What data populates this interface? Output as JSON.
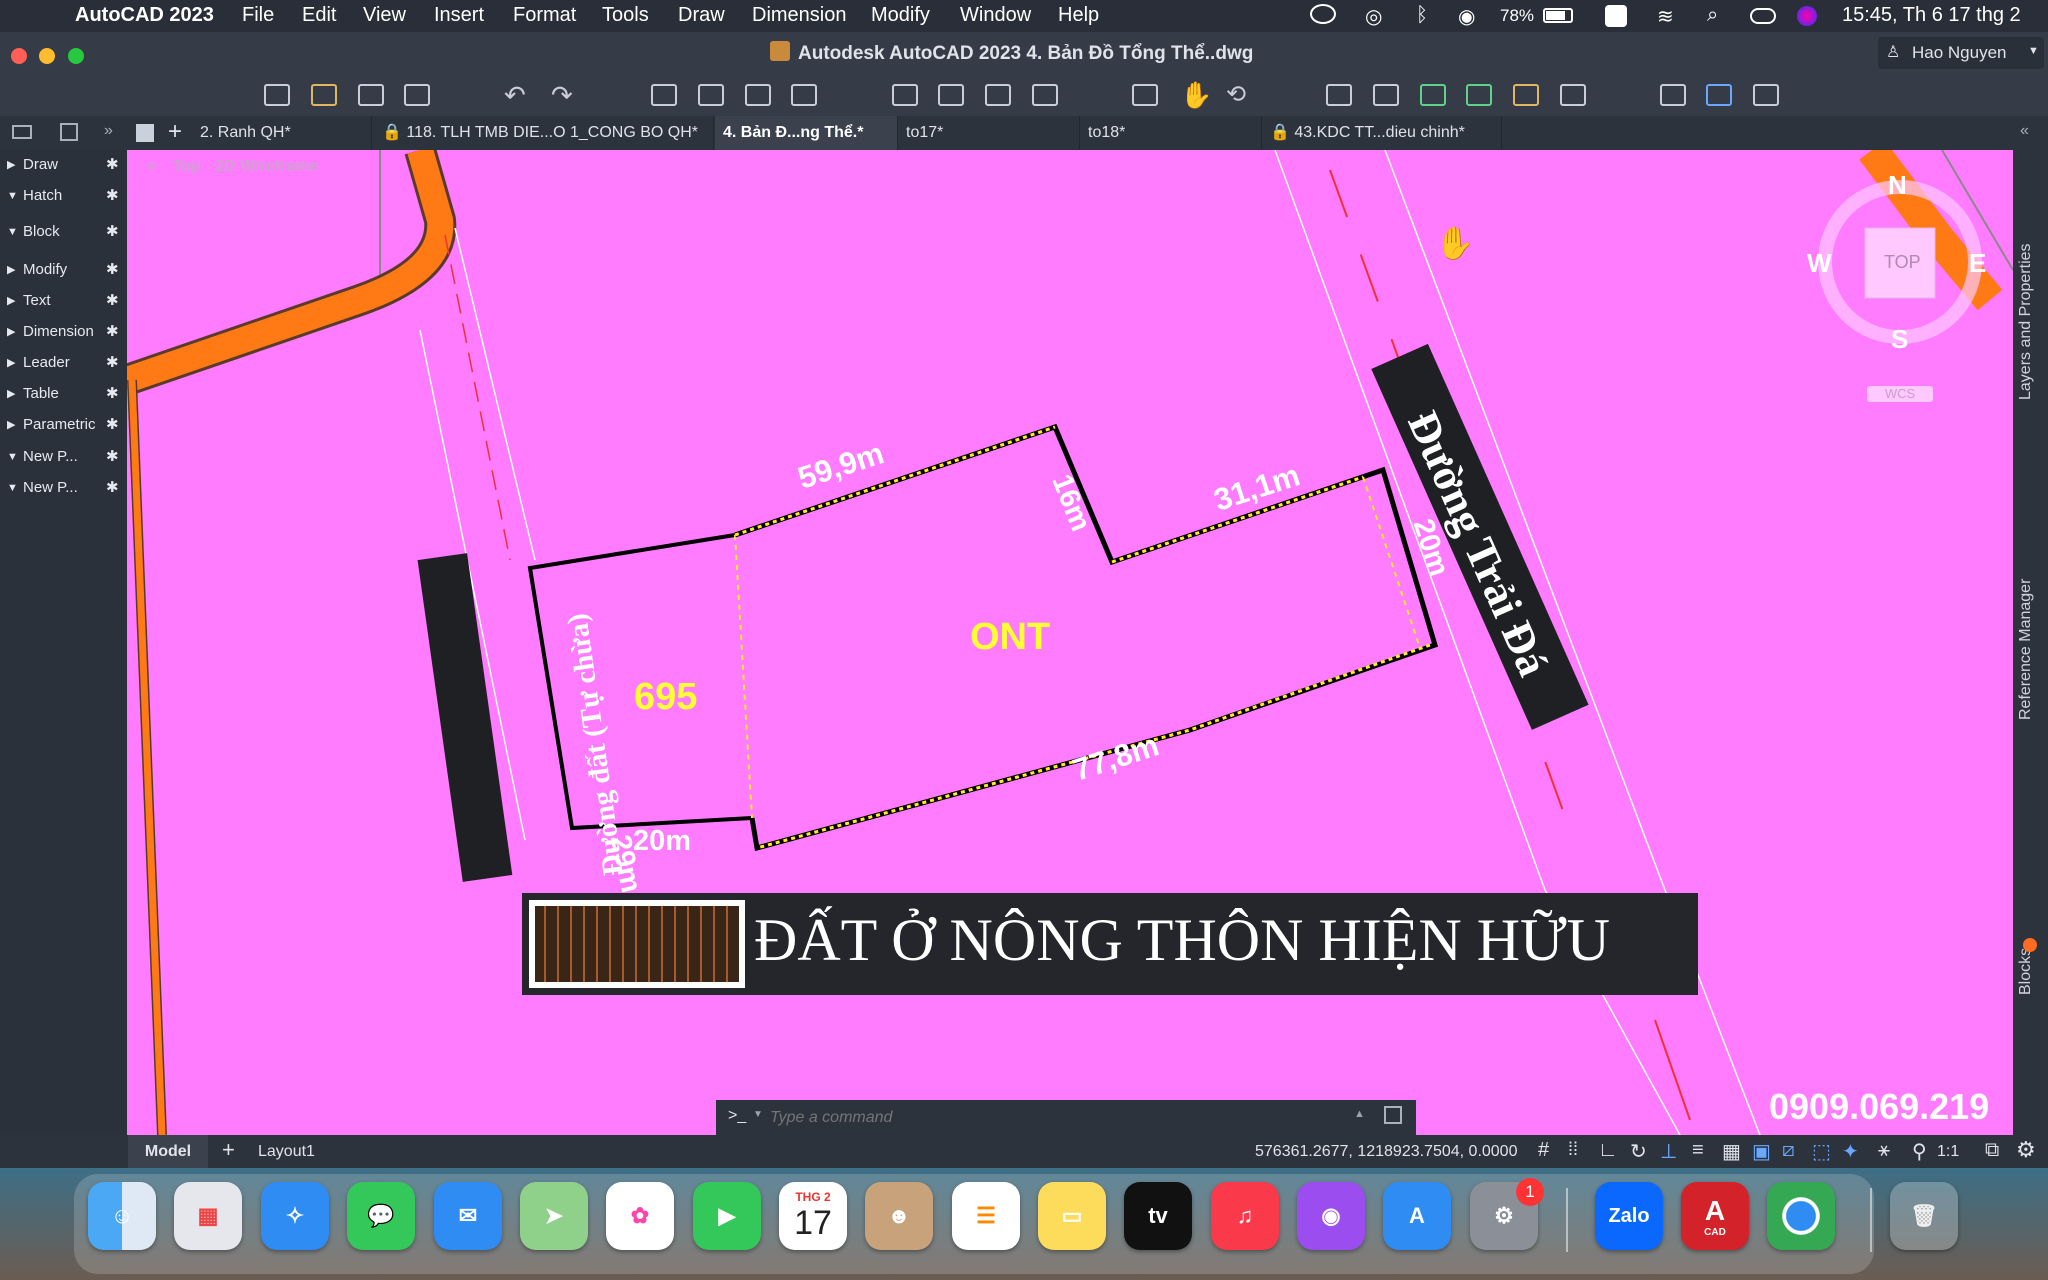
{
  "menubar": {
    "app_name": "AutoCAD 2023",
    "menus": [
      "File",
      "Edit",
      "View",
      "Insert",
      "Format",
      "Tools",
      "Draw",
      "Dimension",
      "Modify",
      "Window",
      "Help"
    ],
    "battery": "78%",
    "datetime": "15:45, Th 6 17 thg 2"
  },
  "titlebar": {
    "title": "Autodesk AutoCAD 2023    4. Bản Đồ Tổng Thể..dwg",
    "user": "Hao Nguyen"
  },
  "tabs": [
    {
      "label": "2. Ranh QH*",
      "locked": false
    },
    {
      "label": "118. TLH TMB DIE...O 1_CONG BO QH*",
      "locked": true
    },
    {
      "label": "4. Bản Đ...ng Thể.*",
      "locked": false,
      "active": true
    },
    {
      "label": "to17*",
      "locked": false
    },
    {
      "label": "to18*",
      "locked": false
    },
    {
      "label": "43.KDC TT...dieu chinh*",
      "locked": true
    }
  ],
  "palette": {
    "items": [
      {
        "label": "Draw",
        "expanded": false
      },
      {
        "label": "Hatch",
        "expanded": true
      },
      {
        "label": "Block",
        "expanded": true
      },
      {
        "label": "Modify",
        "expanded": false
      },
      {
        "label": "Text",
        "expanded": false
      },
      {
        "label": "Dimension",
        "expanded": false
      },
      {
        "label": "Leader",
        "expanded": false
      },
      {
        "label": "Table",
        "expanded": false
      },
      {
        "label": "Parametric",
        "expanded": false
      },
      {
        "label": "New P...",
        "expanded": true
      },
      {
        "label": "New P...",
        "expanded": true
      }
    ]
  },
  "viewport": {
    "view_controls": [
      "+",
      "Top",
      "2D Wireframe"
    ]
  },
  "viewcube": {
    "north": "N",
    "south": "S",
    "east": "E",
    "west": "W",
    "face": "TOP",
    "wcs": "WCS"
  },
  "drawing": {
    "parcel_number": "695",
    "zone_label": "ONT",
    "dimensions": {
      "top_left": "59,9m",
      "notch": "16m",
      "top_right": "31,1m",
      "right": "20m",
      "bottom": "77,8m",
      "left": "29m",
      "bottom_left": "20m"
    },
    "road_left": "Đường đất (Tự chừa)",
    "road_right": "Đường Trải Đá",
    "legend_text": "ĐẤT Ở NÔNG THÔN HIỆN HỮU",
    "phone": "0909.069.219"
  },
  "commandline": {
    "prompt": ">_",
    "placeholder": "Type a command"
  },
  "rightpanels": [
    "Layers and Properties",
    "Reference Manager",
    "Blocks"
  ],
  "statusbar": {
    "tabs": [
      "Model",
      "Layout1"
    ],
    "coords": "576361.2677, 1218923.7504, 0.0000",
    "scale": "1:1"
  },
  "dock": {
    "calendar_month": "THG 2",
    "calendar_day": "17",
    "settings_badge": "1",
    "apps": [
      "Finder",
      "Launchpad",
      "Safari",
      "Messages",
      "Mail",
      "Maps",
      "Photos",
      "FaceTime",
      "Calendar",
      "Contacts",
      "Reminders",
      "Notes",
      "Apple TV",
      "Music",
      "Podcasts",
      "App Store",
      "System Settings",
      "Zalo",
      "AutoCAD",
      "Chrome",
      "Trash"
    ],
    "zalo_label": "Zalo",
    "autocad_label": "A",
    "autocad_sub": "CAD",
    "tv_label": "tv"
  },
  "colors": {
    "canvas": "#ff7bff",
    "road": "#ff7a14",
    "dim_text": "#ffffff",
    "parcel_text": "#ffff33"
  }
}
